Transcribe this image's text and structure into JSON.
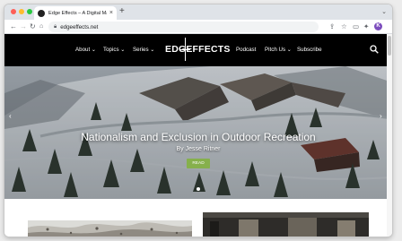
{
  "browser": {
    "tab_title": "Edge Effects – A Digital Maga",
    "url": "edgeeffects.net",
    "new_tab": "+",
    "tab_close": "×",
    "profile_initial": "K"
  },
  "site": {
    "logo": "EDGEFFECTS",
    "nav": [
      {
        "label": "About",
        "caret": "⌄"
      },
      {
        "label": "Topics",
        "caret": "⌄"
      },
      {
        "label": "Series",
        "caret": "⌄"
      },
      {
        "label": "Podcast",
        "caret": ""
      },
      {
        "label": "Pitch Us",
        "caret": "⌄"
      },
      {
        "label": "Subscribe",
        "caret": ""
      }
    ]
  },
  "hero": {
    "title": "Nationalism and Exclusion in Outdoor Recreation",
    "author": "By Jesse Ritner",
    "button": "READ",
    "slide_count": 1,
    "active_slide": 1
  },
  "icons": {
    "back": "arrow-left-icon",
    "forward": "arrow-right-icon",
    "reload": "reload-icon",
    "home": "home-icon",
    "search": "search-icon",
    "star": "star-icon",
    "extensions": "puzzle-icon"
  },
  "colors": {
    "header_bg": "#000000",
    "read_button": "#86b04c",
    "profile": "#7c4dbd"
  }
}
